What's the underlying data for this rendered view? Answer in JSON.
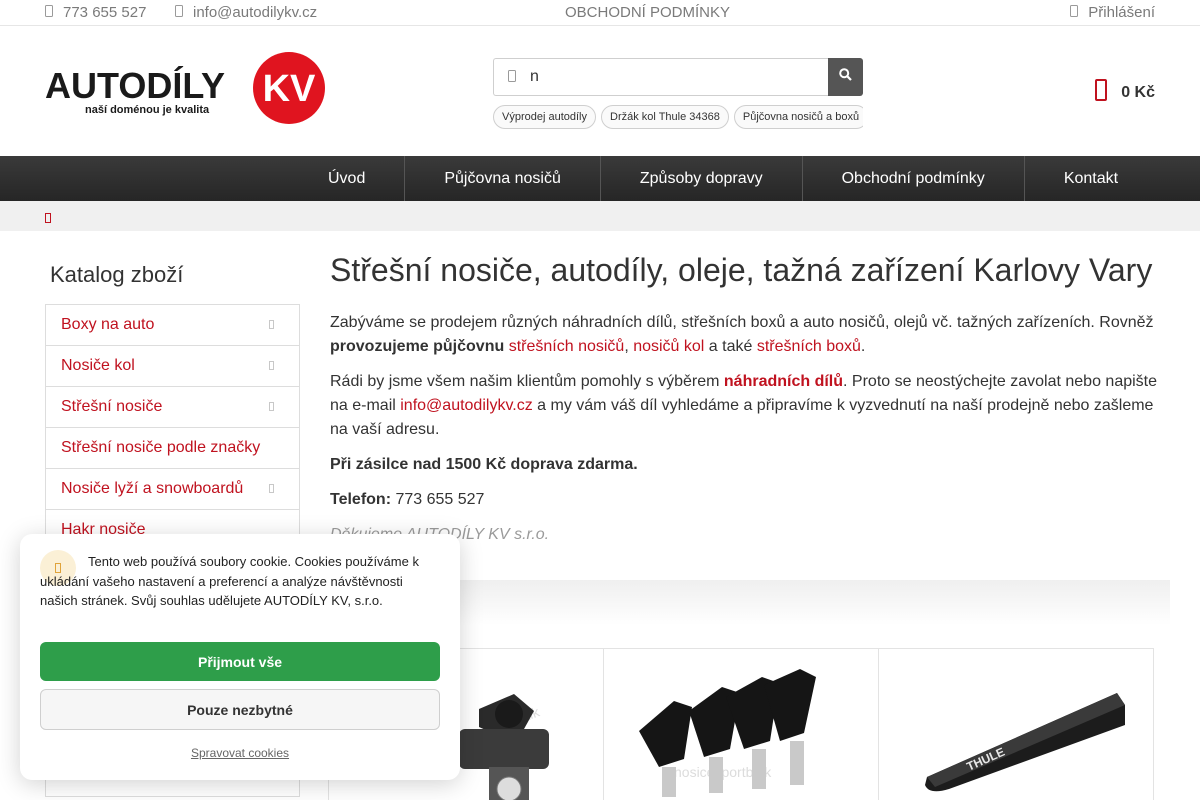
{
  "topbar": {
    "phone": "773 655 527",
    "email": "info@autodilykv.cz",
    "terms": "OBCHODNÍ PODMÍNKY",
    "login": "Přihlášení"
  },
  "logo": {
    "word": "AUTODÍLY",
    "badge": "KV",
    "tagline": "naší doménou je kvalita"
  },
  "search": {
    "value": "n",
    "tags": [
      "Výprodej autodíly",
      "Držák kol Thule 34368",
      "Půjčovna nosičů a boxů"
    ]
  },
  "cart": {
    "total": "0 Kč"
  },
  "nav": [
    "Úvod",
    "Půjčovna nosičů",
    "Způsoby dopravy",
    "Obchodní podmínky",
    "Kontakt"
  ],
  "sidebar": {
    "title": "Katalog zboží",
    "items": [
      {
        "label": "Boxy na auto",
        "has_sub": true
      },
      {
        "label": "Nosiče kol",
        "has_sub": true
      },
      {
        "label": "Střešní nosiče",
        "has_sub": true
      },
      {
        "label": "Střešní nosiče podle značky",
        "has_sub": false
      },
      {
        "label": "Nosiče lyží a snowboardů",
        "has_sub": true
      },
      {
        "label": "Hakr nosiče",
        "has_sub": false
      }
    ]
  },
  "main": {
    "title": "Střešní nosiče, autodíly, oleje, tažná zařízení Karlovy Vary",
    "p1_a": "Zabýváme se prodejem různých náhradních dílů, střešních boxů a auto nosičů, olejů vč. tažných zařízeních. Rovněž ",
    "p1_b": "provozujeme půjčovnu",
    "p1_c": " ",
    "p1_link1": "střešních nosičů",
    "p1_d": ", ",
    "p1_link2": "nosičů kol",
    "p1_e": " a také ",
    "p1_link3": "střešních boxů",
    "p1_f": ".",
    "p2_a": "Rádi by jsme všem našim klientům pomohly s výběrem ",
    "p2_link": "náhradních dílů",
    "p2_b": ". Proto se neostýchejte zavolat nebo napište na e-mail ",
    "p2_email": "info@autodilykv.cz",
    "p2_c": " a my vám váš díl vyhledáme a připravíme k vyzvednutí na naší prodejně nebo zašleme na vaší adresu.",
    "shipping": "Při zásilce nad 1500 Kč doprava zdarma.",
    "phone_label": "Telefon:",
    "phone_value": " 773 655 527",
    "company": "Děkujeme AUTODÍLY KV s.r.o."
  },
  "cookie": {
    "text": "Tento web používá soubory cookie. Cookies používáme k ukládání vašeho nastavení a preferencí a analýze návštěvnosti našich stránek. Svůj souhlas udělujete AUTODÍLY KV, s.r.o.",
    "accept": "Přijmout vše",
    "necessary": "Pouze nezbytné",
    "manage": "Spravovat cookies"
  },
  "products_partial": {
    "brand_on_bar": "THULE",
    "watermark": "nosicesportbalk"
  },
  "colors": {
    "accent_red": "#c0121f",
    "nav_bg": "#2d2d2d",
    "accept_green": "#2e9e4a"
  },
  "icons": [
    "phone-icon",
    "mail-icon",
    "user-icon",
    "search-icon",
    "cart-icon",
    "home-icon",
    "chevron-right-icon",
    "cookie-icon"
  ]
}
